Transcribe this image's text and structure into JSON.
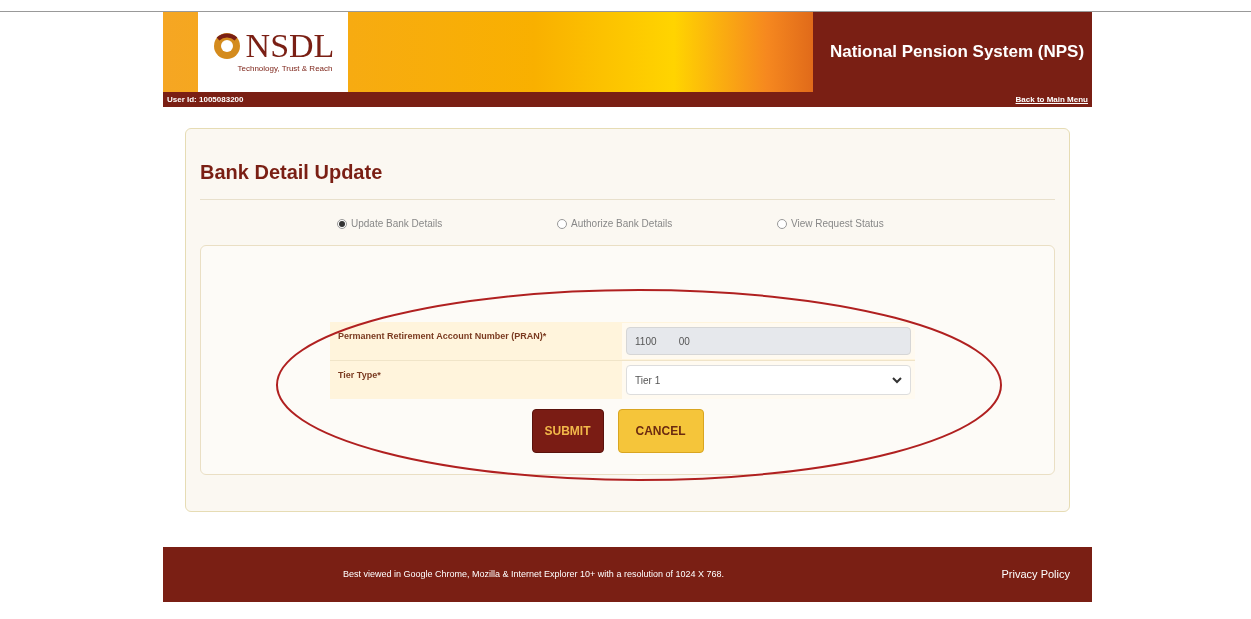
{
  "header": {
    "logo": "NSDL",
    "tagline": "Technology, Trust & Reach",
    "title": "National Pension System (NPS)",
    "user_id": "User Id: 1005083200",
    "back_link": "Back to Main Menu"
  },
  "form": {
    "title": "Bank Detail Update",
    "options": [
      {
        "label": "Update Bank Details",
        "selected": true
      },
      {
        "label": "Authorize Bank Details",
        "selected": false
      },
      {
        "label": "View Request Status",
        "selected": false
      }
    ],
    "fields": [
      {
        "kind": "text",
        "label": "Permanent Retirement Account Number (PRAN)*",
        "value": "1100        00"
      },
      {
        "kind": "select",
        "label": "Tier Type*",
        "value": "Tier 1"
      }
    ],
    "buttons": [
      {
        "kind": "primary",
        "label": "SUBMIT"
      },
      {
        "kind": "secondary",
        "label": "CANCEL"
      }
    ],
    "annotation": {
      "kind": "ellipse"
    }
  },
  "footer": {
    "note": "Best viewed in Google Chrome, Mozilla & Internet Explorer 10+ with a resolution of 1024 X 768.",
    "link": "Privacy Policy"
  }
}
